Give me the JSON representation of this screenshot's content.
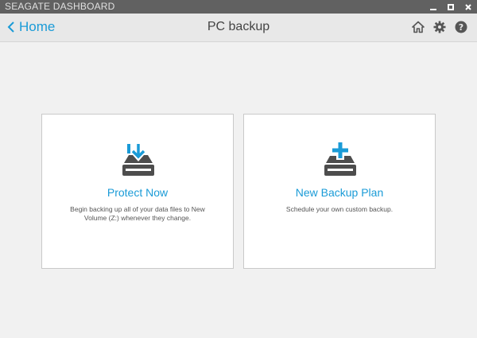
{
  "window": {
    "title": "SEAGATE DASHBOARD",
    "controls": [
      "minimize-icon",
      "maximize-icon",
      "close-icon"
    ]
  },
  "header": {
    "back_label": "Home",
    "title": "PC backup",
    "icons": [
      "home-icon",
      "gear-icon",
      "help-icon"
    ]
  },
  "cards": [
    {
      "title": "Protect Now",
      "description": "Begin backing up all of your data files to New Volume (Z:) whenever they change.",
      "icon": "drive-download-icon"
    },
    {
      "title": "New Backup Plan",
      "description": "Schedule your own custom backup.",
      "icon": "drive-add-icon"
    }
  ],
  "colors": {
    "accent": "#1a9bd7",
    "titlebar": "#616161",
    "icon_gray": "#555555"
  }
}
